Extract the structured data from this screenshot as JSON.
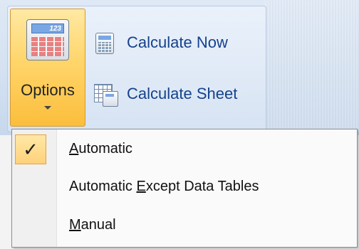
{
  "ribbon": {
    "options": {
      "label": "Options",
      "icon": "calculator-icon",
      "icon_screen_text": "123"
    },
    "commands": [
      {
        "label": "Calculate Now",
        "icon": "calculator-icon"
      },
      {
        "label": "Calculate Sheet",
        "icon": "calculate-sheet-icon"
      }
    ]
  },
  "menu": {
    "items": [
      {
        "label_before": "",
        "access_key": "A",
        "label_after": "utomatic",
        "checked": true
      },
      {
        "label_before": "Automatic ",
        "access_key": "E",
        "label_after": "xcept Data Tables",
        "checked": false
      },
      {
        "label_before": "",
        "access_key": "M",
        "label_after": "anual",
        "checked": false
      }
    ],
    "check_glyph": "✓"
  }
}
